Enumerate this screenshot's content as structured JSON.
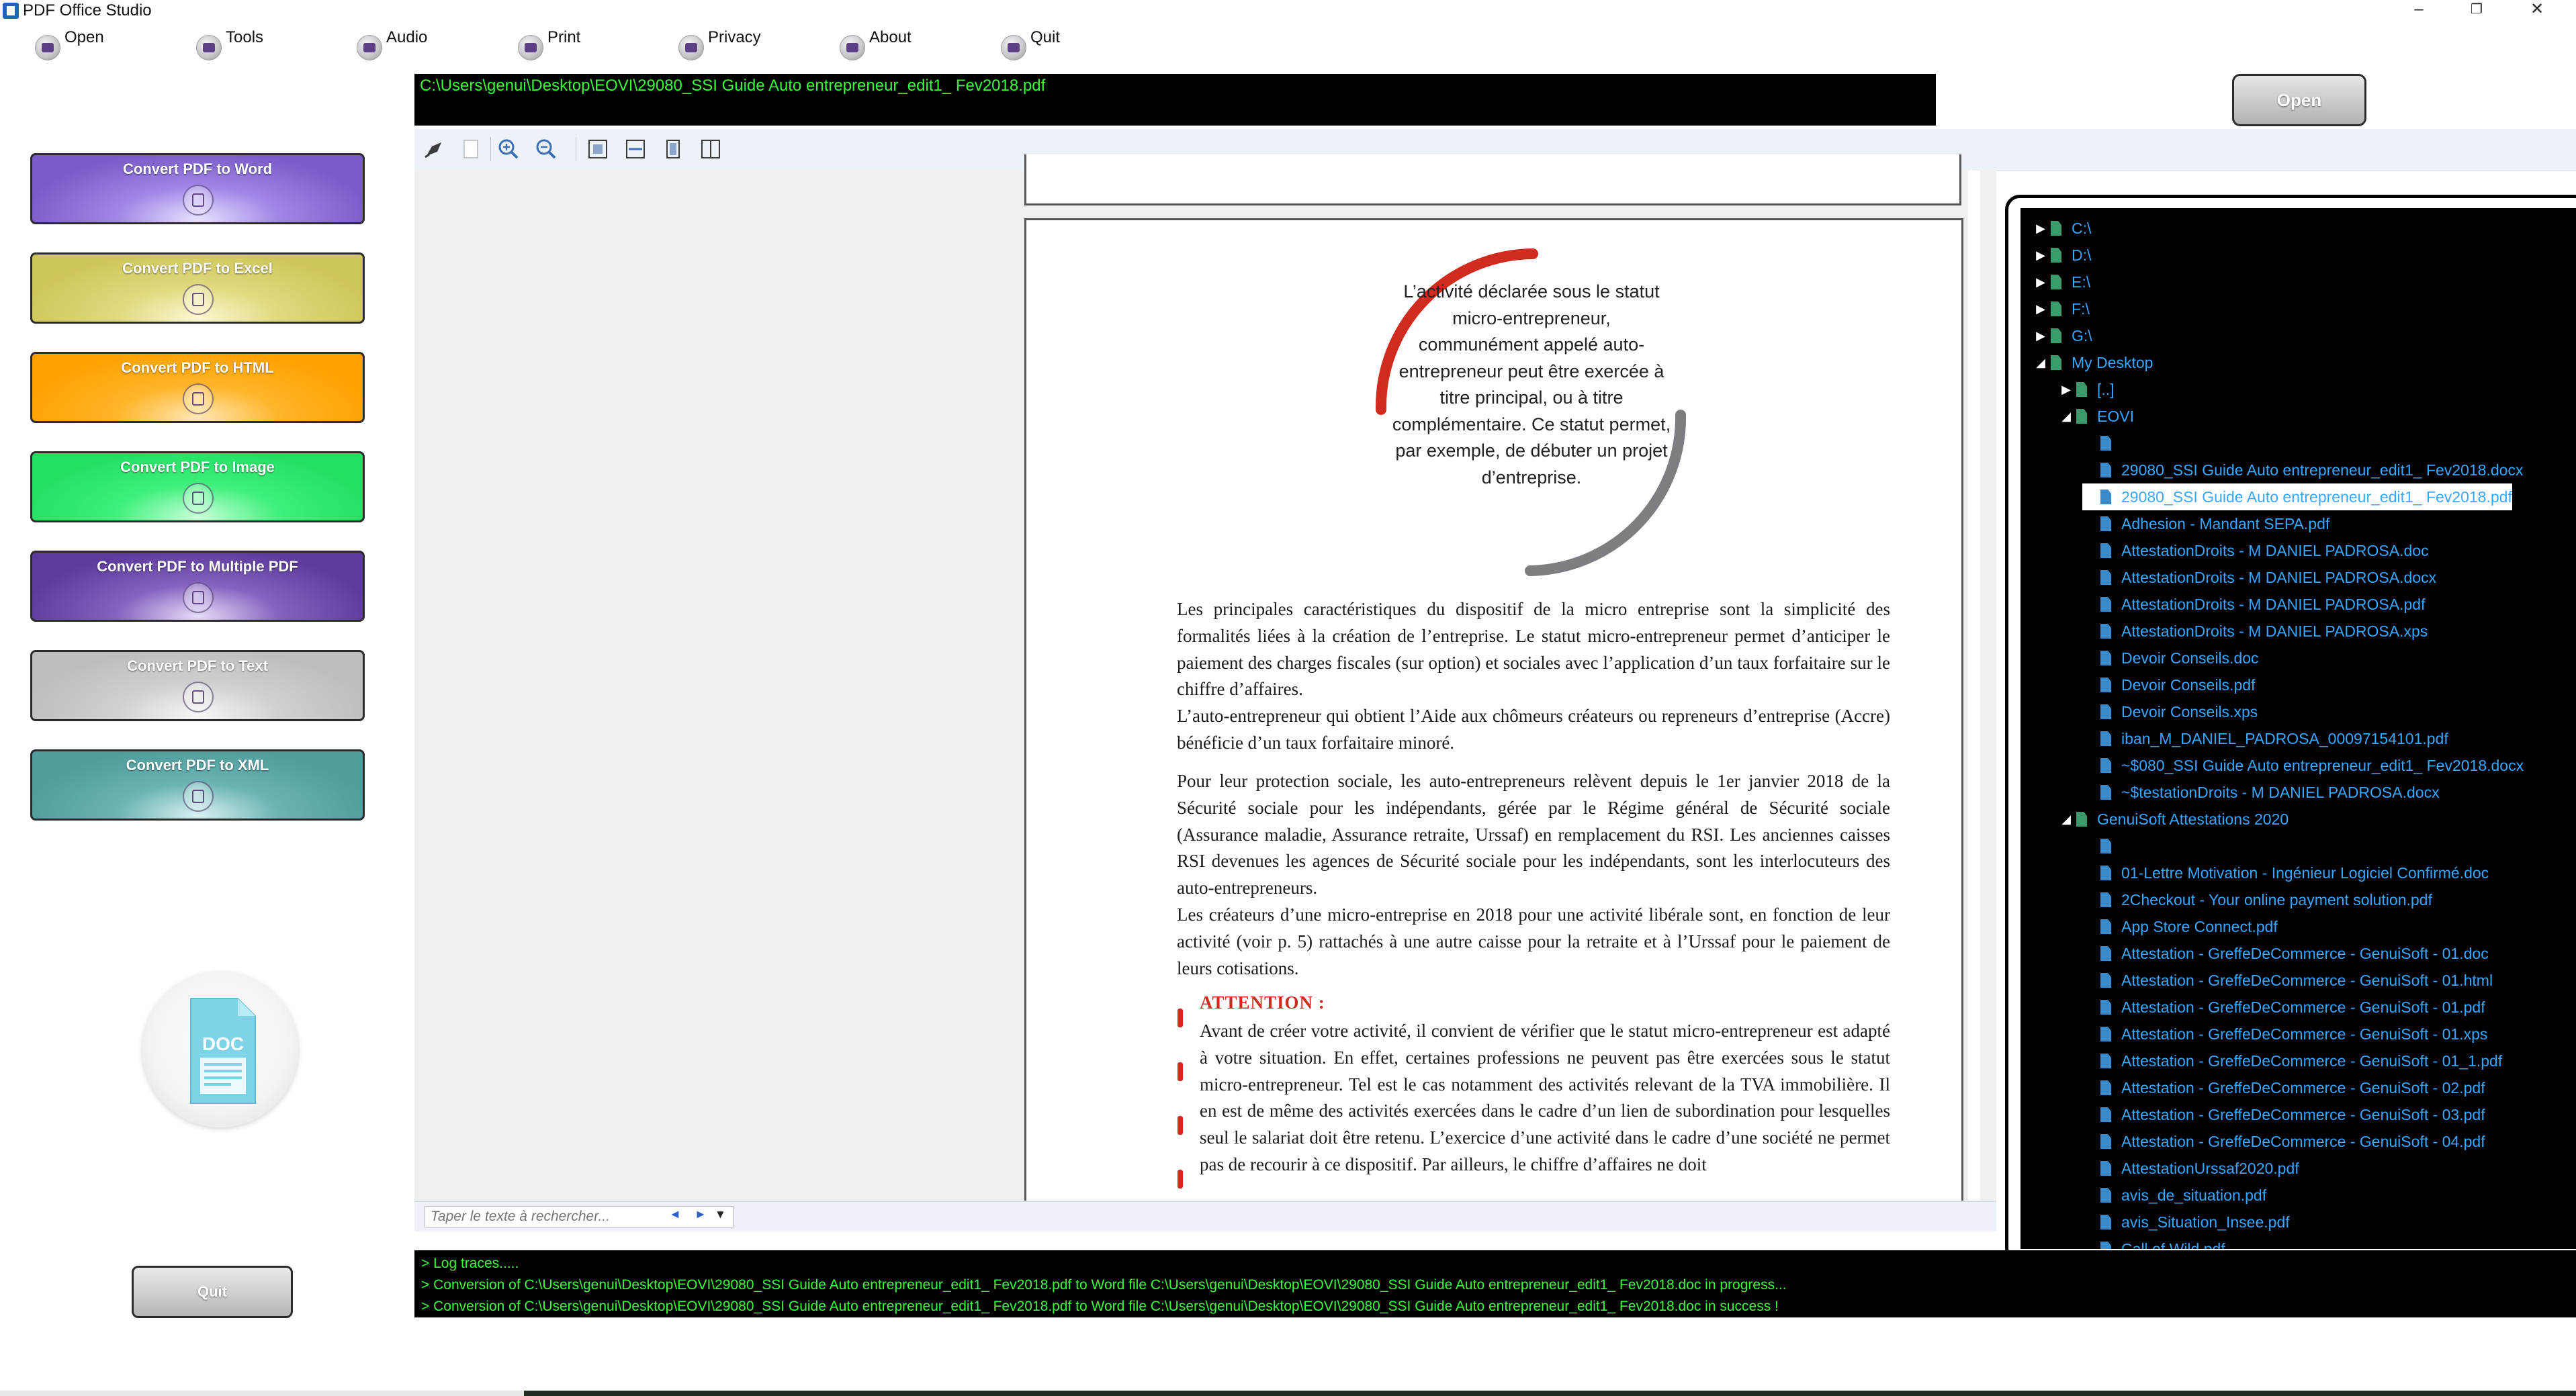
{
  "window": {
    "title": "PDF Office Studio",
    "minimize": "–",
    "maximize": "❐",
    "close": "✕"
  },
  "menu": [
    {
      "label": "Open",
      "icon": "open-icon"
    },
    {
      "label": "Tools",
      "icon": "tools-icon"
    },
    {
      "label": "Audio",
      "icon": "audio-icon"
    },
    {
      "label": "Print",
      "icon": "print-icon"
    },
    {
      "label": "Privacy",
      "icon": "privacy-icon"
    },
    {
      "label": "About",
      "icon": "about-icon"
    },
    {
      "label": "Quit",
      "icon": "quit-icon"
    }
  ],
  "left_panel": {
    "buttons": [
      {
        "label": "Convert PDF to Word",
        "color": "#8c6fd4"
      },
      {
        "label": "Convert PDF to Excel",
        "color": "#d6cf6a"
      },
      {
        "label": "Convert PDF to HTML",
        "color": "#ffaa12"
      },
      {
        "label": "Convert PDF to Image",
        "color": "#2fe66e"
      },
      {
        "label": "Convert PDF to Multiple PDF",
        "color": "#6a43a8"
      },
      {
        "label": "Convert PDF to Text",
        "color": "#c4c4c4"
      },
      {
        "label": "Convert PDF to XML",
        "color": "#5aa6a6"
      }
    ],
    "preview_icon_text": "DOC",
    "quit_label": "Quit"
  },
  "path_bar": {
    "path": "C:\\Users\\genui\\Desktop\\EOVI\\29080_SSI Guide Auto entrepreneur_edit1_ Fev2018.pdf",
    "open_label": "Open"
  },
  "pdf_page": {
    "circle_text": "L’activité déclarée sous le statut micro-entrepreneur, communément appelé auto-entrepreneur peut être exercée à titre principal, ou à titre complémentaire. Ce statut permet, par exemple, de débuter un projet d’entreprise.",
    "para1": "Les principales caractéristiques du dispositif de la micro entreprise sont la simplicité des formalités liées à la création de l’entreprise. Le statut micro-entrepreneur permet d’anticiper le paiement des charges fiscales (sur option) et sociales avec l’application d’un taux forfaitaire sur le chiffre d’affaires.",
    "para2": "L’auto-entrepreneur qui obtient l’Aide aux chômeurs créateurs ou repreneurs d’entreprise (Accre) bénéficie d’un taux forfaitaire minoré.",
    "para3": "Pour leur protection sociale, les auto-entrepreneurs relèvent depuis le 1er janvier 2018 de la Sécurité sociale pour les indépendants, gérée par le Régime général de Sécurité sociale (Assurance maladie, Assurance retraite, Urssaf) en remplacement du RSI. Les anciennes caisses RSI devenues les agences de Sécurité sociale pour les indépendants, sont les interlocuteurs des auto-entrepreneurs.",
    "para4": "Les créateurs d’une micro-entreprise en 2018 pour une activité libérale sont, en fonction de leur activité  (voir p. 5) rattachés à une autre caisse pour la retraite et à l’Urssaf pour le paiement de leurs cotisations.",
    "attention_title": "ATTENTION :",
    "attention_body": "Avant de créer votre activité, il convient de vérifier que le statut micro-entrepreneur est adapté à votre situation. En effet, certaines professions ne peuvent pas être exercées sous le statut micro-entrepreneur. Tel est le cas notamment des activités relevant de la TVA immobilière. Il en est de même des activités exercées dans le cadre d’un lien de subordination pour lesquelles seul le salariat doit être retenu. L’exercice d’une activité dans le cadre d’une société ne permet pas de recourir à ce dispositif. Par ailleurs, le chiffre d’affaires ne doit"
  },
  "search": {
    "placeholder": "Taper le texte à rechercher...",
    "prev": "◄",
    "next": "►",
    "dropdown": "▼"
  },
  "tree": {
    "nodes": [
      {
        "label": "C:\\",
        "level": 0,
        "arrow": "▶",
        "icon": "drive"
      },
      {
        "label": "D:\\",
        "level": 0,
        "arrow": "▶",
        "icon": "drive"
      },
      {
        "label": "E:\\",
        "level": 0,
        "arrow": "▶",
        "icon": "drive"
      },
      {
        "label": "F:\\",
        "level": 0,
        "arrow": "▶",
        "icon": "drive"
      },
      {
        "label": "G:\\",
        "level": 0,
        "arrow": "▶",
        "icon": "drive"
      },
      {
        "label": "My Desktop",
        "level": 0,
        "arrow": "◢",
        "icon": "folder"
      },
      {
        "label": "[..]",
        "level": 1,
        "arrow": "▶",
        "icon": "folder"
      },
      {
        "label": "EOVI",
        "level": 1,
        "arrow": "◢",
        "icon": "folder"
      },
      {
        "label": "",
        "level": 2,
        "arrow": "",
        "icon": "doc"
      },
      {
        "label": "29080_SSI Guide Auto entrepreneur_edit1_ Fev2018.docx",
        "level": 2,
        "arrow": "",
        "icon": "doc"
      },
      {
        "label": "29080_SSI Guide Auto entrepreneur_edit1_ Fev2018.pdf",
        "level": 2,
        "arrow": "",
        "icon": "doc",
        "selected": true
      },
      {
        "label": "Adhesion - Mandant SEPA.pdf",
        "level": 2,
        "arrow": "",
        "icon": "doc"
      },
      {
        "label": "AttestationDroits - M DANIEL PADROSA.doc",
        "level": 2,
        "arrow": "",
        "icon": "doc"
      },
      {
        "label": "AttestationDroits - M DANIEL PADROSA.docx",
        "level": 2,
        "arrow": "",
        "icon": "doc"
      },
      {
        "label": "AttestationDroits - M DANIEL PADROSA.pdf",
        "level": 2,
        "arrow": "",
        "icon": "doc"
      },
      {
        "label": "AttestationDroits - M DANIEL PADROSA.xps",
        "level": 2,
        "arrow": "",
        "icon": "doc"
      },
      {
        "label": "Devoir Conseils.doc",
        "level": 2,
        "arrow": "",
        "icon": "doc"
      },
      {
        "label": "Devoir Conseils.pdf",
        "level": 2,
        "arrow": "",
        "icon": "doc"
      },
      {
        "label": "Devoir Conseils.xps",
        "level": 2,
        "arrow": "",
        "icon": "doc"
      },
      {
        "label": "iban_M_DANIEL_PADROSA_00097154101.pdf",
        "level": 2,
        "arrow": "",
        "icon": "doc"
      },
      {
        "label": "~$080_SSI Guide Auto entrepreneur_edit1_ Fev2018.docx",
        "level": 2,
        "arrow": "",
        "icon": "doc"
      },
      {
        "label": "~$testationDroits - M DANIEL PADROSA.docx",
        "level": 2,
        "arrow": "",
        "icon": "doc"
      },
      {
        "label": "GenuiSoft Attestations 2020",
        "level": 1,
        "arrow": "◢",
        "icon": "folder"
      },
      {
        "label": "",
        "level": 2,
        "arrow": "",
        "icon": "doc"
      },
      {
        "label": "01-Lettre Motivation - Ingénieur Logiciel Confirmé.doc",
        "level": 2,
        "arrow": "",
        "icon": "doc"
      },
      {
        "label": "2Checkout - Your online payment solution.pdf",
        "level": 2,
        "arrow": "",
        "icon": "doc"
      },
      {
        "label": "App Store Connect.pdf",
        "level": 2,
        "arrow": "",
        "icon": "doc"
      },
      {
        "label": "Attestation - GreffeDeCommerce - GenuiSoft - 01.doc",
        "level": 2,
        "arrow": "",
        "icon": "doc"
      },
      {
        "label": "Attestation - GreffeDeCommerce - GenuiSoft - 01.html",
        "level": 2,
        "arrow": "",
        "icon": "doc"
      },
      {
        "label": "Attestation - GreffeDeCommerce - GenuiSoft - 01.pdf",
        "level": 2,
        "arrow": "",
        "icon": "doc"
      },
      {
        "label": "Attestation - GreffeDeCommerce - GenuiSoft - 01.xps",
        "level": 2,
        "arrow": "",
        "icon": "doc"
      },
      {
        "label": "Attestation - GreffeDeCommerce - GenuiSoft - 01_1.pdf",
        "level": 2,
        "arrow": "",
        "icon": "doc"
      },
      {
        "label": "Attestation - GreffeDeCommerce - GenuiSoft - 02.pdf",
        "level": 2,
        "arrow": "",
        "icon": "doc"
      },
      {
        "label": "Attestation - GreffeDeCommerce - GenuiSoft - 03.pdf",
        "level": 2,
        "arrow": "",
        "icon": "doc"
      },
      {
        "label": "Attestation - GreffeDeCommerce - GenuiSoft - 04.pdf",
        "level": 2,
        "arrow": "",
        "icon": "doc"
      },
      {
        "label": "AttestationUrssaf2020.pdf",
        "level": 2,
        "arrow": "",
        "icon": "doc"
      },
      {
        "label": "avis_de_situation.pdf",
        "level": 2,
        "arrow": "",
        "icon": "doc"
      },
      {
        "label": "avis_Situation_Insee.pdf",
        "level": 2,
        "arrow": "",
        "icon": "doc"
      },
      {
        "label": "Call of Wild.pdf",
        "level": 2,
        "arrow": "",
        "icon": "doc"
      }
    ]
  },
  "log": {
    "lines": [
      "> Log traces.....",
      "> Conversion of C:\\Users\\genui\\Desktop\\EOVI\\29080_SSI Guide Auto entrepreneur_edit1_ Fev2018.pdf to Word file C:\\Users\\genui\\Desktop\\EOVI\\29080_SSI Guide Auto entrepreneur_edit1_ Fev2018.doc in progress...",
      "> Conversion of C:\\Users\\genui\\Desktop\\EOVI\\29080_SSI Guide Auto entrepreneur_edit1_ Fev2018.pdf to Word file C:\\Users\\genui\\Desktop\\EOVI\\29080_SSI Guide Auto entrepreneur_edit1_ Fev2018.doc in success !"
    ]
  }
}
